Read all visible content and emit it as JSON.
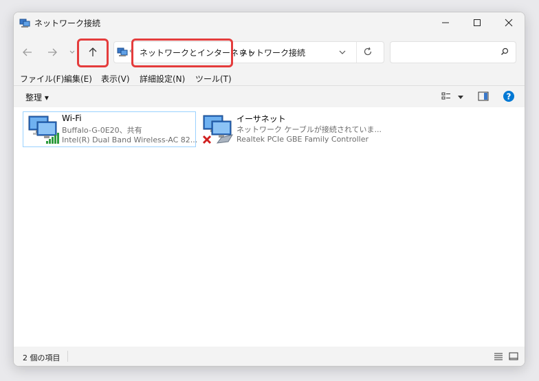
{
  "window": {
    "title": "ネットワーク接続",
    "minimize": "—",
    "maximize": "☐",
    "close": "✕"
  },
  "address": {
    "crumbs": [
      "ネットワークとインターネット",
      "ネットワーク接続"
    ],
    "search_placeholder": ""
  },
  "menu": {
    "items": [
      "ファイル(F)",
      "編集(E)",
      "表示(V)",
      "詳細設定(N)",
      "ツール(T)"
    ]
  },
  "toolbar": {
    "organize_label": "整理 ▾"
  },
  "items": [
    {
      "name": "Wi-Fi",
      "status": "Buffalo-G-0E20、共有",
      "device": "Intel(R) Dual Band Wireless-AC 82..."
    },
    {
      "name": "イーサネット",
      "status": "ネットワーク ケーブルが接続されていま...",
      "device": "Realtek PCIe GBE Family Controller"
    }
  ],
  "status": {
    "count_text": "2 個の項目"
  },
  "colors": {
    "highlight": "#e43c3c",
    "selection_border": "#99d1ff",
    "help": "#0078d4"
  }
}
